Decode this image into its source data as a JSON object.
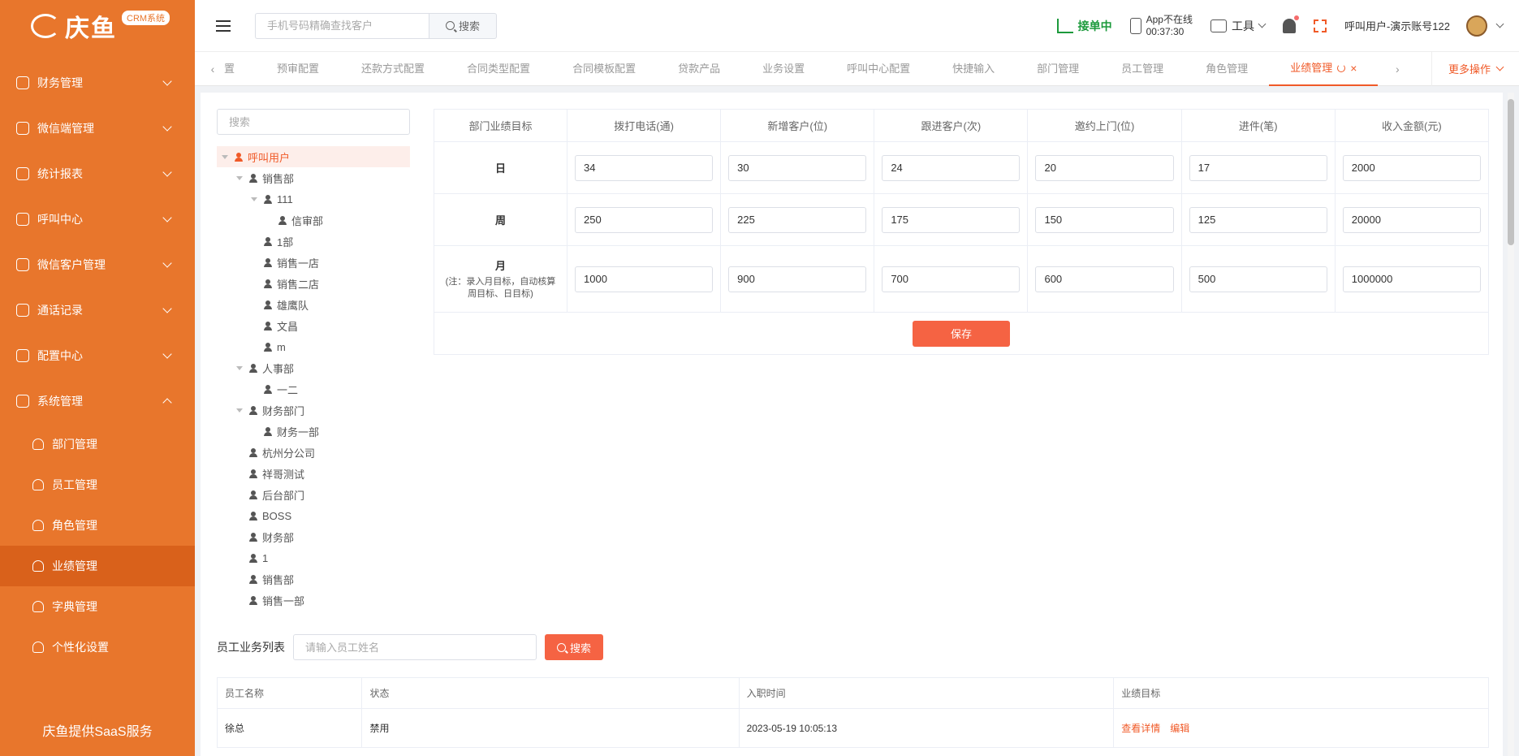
{
  "sidebar": {
    "brand": "庆鱼",
    "brand_badge": "CRM系统",
    "groups": [
      {
        "label": "财务管理",
        "icon": "finance-icon"
      },
      {
        "label": "微信端管理",
        "icon": "wechat-icon"
      },
      {
        "label": "统计报表",
        "icon": "report-icon"
      },
      {
        "label": "呼叫中心",
        "icon": "call-center-icon"
      },
      {
        "label": "微信客户管理",
        "icon": "wechat-customer-icon"
      },
      {
        "label": "通话记录",
        "icon": "phone-icon"
      },
      {
        "label": "配置中心",
        "icon": "gear-icon"
      },
      {
        "label": "系统管理",
        "icon": "gear-icon"
      }
    ],
    "sub_items": [
      {
        "label": "部门管理",
        "icon": "user-icon"
      },
      {
        "label": "员工管理",
        "icon": "user-icon"
      },
      {
        "label": "角色管理",
        "icon": "user-icon"
      },
      {
        "label": "业绩管理",
        "icon": "grid-icon"
      },
      {
        "label": "字典管理",
        "icon": "book-icon"
      },
      {
        "label": "个性化设置",
        "icon": "tag-icon"
      }
    ],
    "footer": "庆鱼提供SaaS服务"
  },
  "header": {
    "search_placeholder": "手机号码精确查找客户",
    "search_button": "搜索",
    "status_online": "接单中",
    "app_status_line1": "App不在线",
    "app_status_line2": "00:37:30",
    "tools_label": "工具",
    "user_name": "呼叫用户-演示账号122"
  },
  "tabs": {
    "items": [
      "置",
      "预审配置",
      "还款方式配置",
      "合同类型配置",
      "合同模板配置",
      "贷款产品",
      "业务设置",
      "呼叫中心配置",
      "快捷输入",
      "部门管理",
      "员工管理",
      "角色管理"
    ],
    "active": "业绩管理",
    "more_ops": "更多操作"
  },
  "tree": {
    "search_placeholder": "搜索",
    "nodes": [
      {
        "label": "呼叫用户",
        "level": 0,
        "caret": true
      },
      {
        "label": "销售部",
        "level": 1,
        "caret": true
      },
      {
        "label": "111",
        "level": 2,
        "caret": true
      },
      {
        "label": "信审部",
        "level": 3,
        "caret": false
      },
      {
        "label": "1部",
        "level": 2,
        "caret": false
      },
      {
        "label": "销售一店",
        "level": 2,
        "caret": false
      },
      {
        "label": "销售二店",
        "level": 2,
        "caret": false
      },
      {
        "label": "雄鹰队",
        "level": 2,
        "caret": false
      },
      {
        "label": "文昌",
        "level": 2,
        "caret": false
      },
      {
        "label": "m",
        "level": 2,
        "caret": false
      },
      {
        "label": "人事部",
        "level": 1,
        "caret": true
      },
      {
        "label": "一二",
        "level": 2,
        "caret": false
      },
      {
        "label": "财务部门",
        "level": 1,
        "caret": true
      },
      {
        "label": "财务一部",
        "level": 2,
        "caret": false
      },
      {
        "label": "杭州分公司",
        "level": 1,
        "caret": false
      },
      {
        "label": "祥哥测试",
        "level": 1,
        "caret": false
      },
      {
        "label": "后台部门",
        "level": 1,
        "caret": false
      },
      {
        "label": "BOSS",
        "level": 1,
        "caret": false
      },
      {
        "label": "财务部",
        "level": 1,
        "caret": false
      },
      {
        "label": "1",
        "level": 1,
        "caret": false
      },
      {
        "label": "销售部",
        "level": 1,
        "caret": false
      },
      {
        "label": "销售一部",
        "level": 1,
        "caret": false
      }
    ]
  },
  "targets": {
    "headers": [
      "部门业绩目标",
      "拨打电话(通)",
      "新增客户(位)",
      "跟进客户(次)",
      "邀约上门(位)",
      "进件(笔)",
      "收入金额(元)"
    ],
    "rows": [
      {
        "label": "日",
        "note": "",
        "values": [
          "34",
          "30",
          "24",
          "20",
          "17",
          "2000"
        ]
      },
      {
        "label": "周",
        "note": "",
        "values": [
          "250",
          "225",
          "175",
          "150",
          "125",
          "20000"
        ]
      },
      {
        "label": "月",
        "note": "(注：录入月目标，自动核算周目标、日目标)",
        "values": [
          "1000",
          "900",
          "700",
          "600",
          "500",
          "1000000"
        ]
      }
    ],
    "save_label": "保存"
  },
  "employees": {
    "label": "员工业务列表",
    "placeholder": "请输入员工姓名",
    "search_button": "搜索",
    "headers": [
      "员工名称",
      "状态",
      "入职时间",
      "业绩目标"
    ],
    "rows": [
      {
        "name": "徐总",
        "status": "禁用",
        "joined": "2023-05-19 10:05:13",
        "view": "查看详情",
        "edit": "编辑"
      }
    ]
  }
}
